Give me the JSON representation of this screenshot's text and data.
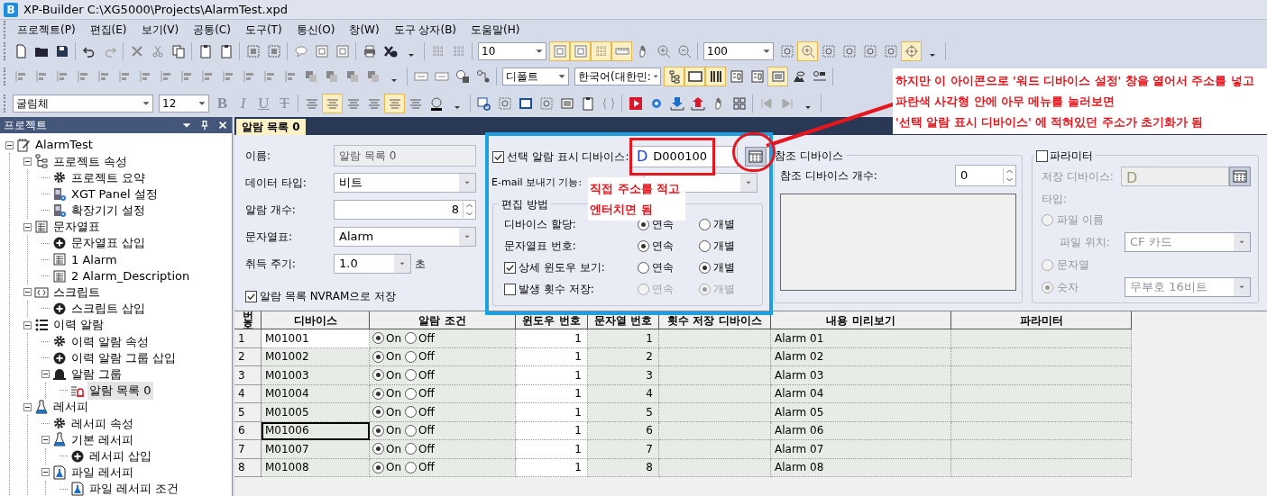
{
  "window": {
    "logo": "B",
    "title": "XP-Builder C:\\XG5000\\Projects\\AlarmTest.xpd"
  },
  "menu": [
    "프로젝트(P)",
    "편집(E)",
    "보기(V)",
    "공통(C)",
    "도구(T)",
    "통신(O)",
    "창(W)",
    "도구 상자(B)",
    "도움말(H)"
  ],
  "toolbar": {
    "rows": [
      [
        {
          "kind": "buttons",
          "buttons": [
            {
              "selected": false
            },
            {
              "selected": false
            },
            {
              "selected": false
            },
            {
              "selected": false
            },
            {
              "selected": false
            },
            {
              "selected": false
            },
            {
              "selected": false
            },
            {
              "selected": false
            },
            {
              "selected": false
            },
            {
              "selected": false
            },
            {
              "selected": false
            },
            {
              "selected": false
            },
            {
              "selected": false
            },
            {
              "selected": false
            },
            {
              "selected": false
            },
            {
              "selected": false
            },
            {
              "selected": false
            },
            {
              "selected": false
            },
            {
              "selected": false
            },
            {
              "selected": false
            }
          ]
        },
        {
          "kind": "field",
          "value": "10"
        },
        {
          "kind": "buttons",
          "buttons": [
            {
              "selected": true
            },
            {
              "selected": true
            },
            {
              "selected": true
            },
            {
              "selected": true
            },
            {
              "selected": false
            },
            {
              "selected": false
            },
            {
              "selected": false
            }
          ]
        },
        {
          "kind": "field",
          "value": "100"
        },
        {
          "kind": "buttons",
          "buttons": [
            {
              "selected": false
            },
            {
              "selected": true
            },
            {
              "selected": false
            },
            {
              "selected": false
            },
            {
              "selected": false
            },
            {
              "selected": false
            },
            {
              "selected": true
            },
            {
              "selected": false
            }
          ]
        }
      ],
      [
        {
          "kind": "buttons",
          "buttons": [
            {
              "selected": false
            },
            {
              "selected": false
            },
            {
              "selected": false
            },
            {
              "selected": false
            },
            {
              "selected": false
            },
            {
              "selected": false
            },
            {
              "selected": false
            },
            {
              "selected": false
            },
            {
              "selected": false
            },
            {
              "selected": false
            },
            {
              "selected": false
            },
            {
              "selected": false
            },
            {
              "selected": false
            },
            {
              "selected": false
            },
            {
              "selected": false
            },
            {
              "selected": false
            },
            {
              "selected": false
            },
            {
              "selected": false
            },
            {
              "selected": false
            },
            {
              "selected": false
            },
            {
              "selected": false
            },
            {
              "selected": false
            },
            {
              "selected": false
            }
          ]
        },
        {
          "kind": "field",
          "value": "디폴트"
        },
        {
          "kind": "field",
          "value": "한국어(대한민:"
        },
        {
          "kind": "buttons",
          "buttons": [
            {
              "selected": true
            },
            {
              "selected": true
            },
            {
              "selected": true
            },
            {
              "selected": false
            },
            {
              "selected": false
            },
            {
              "selected": true
            },
            {
              "selected": false
            },
            {
              "selected": false
            }
          ]
        }
      ],
      [
        {
          "kind": "field",
          "value": "굴림체"
        },
        {
          "kind": "field",
          "value": "12"
        },
        {
          "kind": "format",
          "buttons": [
            {
              "label": "B",
              "kind": "bold"
            },
            {
              "label": "I",
              "kind": "italic"
            },
            {
              "label": "U",
              "kind": "underline"
            },
            {
              "label": "T",
              "kind": "strike"
            }
          ]
        },
        {
          "kind": "buttons",
          "buttons": [
            {
              "selected": false
            },
            {
              "selected": true
            },
            {
              "selected": false
            },
            {
              "selected": false
            },
            {
              "selected": true
            },
            {
              "selected": false
            },
            {
              "selected": false
            },
            {
              "selected": false
            }
          ]
        },
        {
          "kind": "buttons",
          "buttons": [
            {
              "selected": false
            },
            {
              "selected": false
            },
            {
              "selected": false
            },
            {
              "selected": false
            },
            {
              "selected": false
            },
            {
              "selected": false
            },
            {
              "selected": false
            },
            {
              "selected": false
            },
            {
              "selected": false
            },
            {
              "selected": false
            },
            {
              "selected": false
            },
            {
              "selected": false
            },
            {
              "selected": false
            },
            {
              "selected": false
            },
            {
              "selected": false
            },
            {
              "selected": false
            }
          ]
        }
      ]
    ]
  },
  "project_panel": {
    "title": "프로젝트",
    "tree": [
      {
        "label": "AlarmTest",
        "kind": "project",
        "selected": false,
        "expanded": true,
        "children": [
          {
            "label": "프로젝트 속성",
            "kind": "properties",
            "selected": false,
            "expanded": true,
            "children": [
              {
                "label": "프로젝트 요약",
                "kind": "summary",
                "selected": false
              },
              {
                "label": "XGT Panel 설정",
                "kind": "settings",
                "selected": false
              },
              {
                "label": "확장기기 설정",
                "kind": "settings",
                "selected": false
              }
            ]
          },
          {
            "label": "문자열표",
            "kind": "table",
            "selected": false,
            "expanded": true,
            "children": [
              {
                "label": "문자열표 삽입",
                "kind": "insert",
                "selected": false
              },
              {
                "label": "1 Alarm",
                "kind": "table",
                "selected": false
              },
              {
                "label": "2 Alarm_Description",
                "kind": "table",
                "selected": false
              }
            ]
          },
          {
            "label": "스크립트",
            "kind": "script",
            "selected": false,
            "expanded": true,
            "children": [
              {
                "label": "스크립트 삽입",
                "kind": "insert",
                "selected": false
              }
            ]
          },
          {
            "label": "이력 알람",
            "kind": "history",
            "selected": false,
            "expanded": true,
            "children": [
              {
                "label": "이력 알람 속성",
                "kind": "summary",
                "selected": false
              },
              {
                "label": "이력 알람 그룹 삽입",
                "kind": "insert",
                "selected": false
              },
              {
                "label": "알람 그룹",
                "kind": "group",
                "selected": false,
                "expanded": true,
                "children": [
                  {
                    "label": "알람 목록 0",
                    "kind": "list",
                    "selected": true
                  }
                ]
              }
            ]
          },
          {
            "label": "레서피",
            "kind": "recipe",
            "selected": false,
            "expanded": true,
            "children": [
              {
                "label": "레서피 속성",
                "kind": "summary",
                "selected": false
              },
              {
                "label": "기본 레서피",
                "kind": "recipe",
                "selected": false,
                "expanded": true,
                "children": [
                  {
                    "label": "레서피 삽입",
                    "kind": "insert",
                    "selected": false
                  }
                ]
              },
              {
                "label": "파일 레서피",
                "kind": "file",
                "selected": false,
                "expanded": true,
                "children": [
                  {
                    "label": "파일 레서피 조건",
                    "kind": "file",
                    "selected": false
                  }
                ]
              }
            ]
          }
        ]
      }
    ]
  },
  "editor": {
    "tabs": [
      {
        "label": "알람 목록 0",
        "selected": true
      }
    ],
    "general": {
      "name": {
        "label": "이름:",
        "value": "알람 목록 0"
      },
      "data_type": {
        "label": "데이터 타입:",
        "value": "비트"
      },
      "alarm_count": {
        "label": "알람 개수:",
        "value": "8"
      },
      "string_table": {
        "label": "문자열표:",
        "value": "Alarm"
      },
      "interval": {
        "label": "취득 주기:",
        "value": "1.0",
        "unit": "초"
      },
      "nvram": {
        "label": "알람 목록 NVRAM으로 저장",
        "checked": true
      }
    },
    "display_device": {
      "label": "선택 알람 표시 디바이스:",
      "checked": true,
      "prefix": "D",
      "value": "D000100"
    },
    "email": {
      "label": "E-mail 보내기 기능:"
    },
    "edit_method": {
      "title": "편집 방법",
      "rows": [
        {
          "label": "디바이스 할당:",
          "kind": "plain",
          "disabled": false,
          "options": [
            {
              "label": "연속",
              "selected": true
            },
            {
              "label": "개별",
              "selected": false
            }
          ]
        },
        {
          "label": "문자열표 번호:",
          "kind": "plain",
          "disabled": false,
          "options": [
            {
              "label": "연속",
              "selected": true
            },
            {
              "label": "개별",
              "selected": false
            }
          ]
        },
        {
          "label": "상세 윈도우 보기:",
          "kind": "check",
          "checked": true,
          "disabled": false,
          "options": [
            {
              "label": "연속",
              "selected": false
            },
            {
              "label": "개별",
              "selected": true
            }
          ]
        },
        {
          "label": "발생 횟수 저장:",
          "kind": "check",
          "checked": false,
          "disabled": true,
          "options": [
            {
              "label": "연속",
              "selected": false
            },
            {
              "label": "개별",
              "selected": true
            }
          ]
        }
      ]
    },
    "reference": {
      "title": "참조 디바이스",
      "count": {
        "label": "참조 디바이스 개수:",
        "value": "0"
      }
    },
    "parameter": {
      "title": "파라미터",
      "checked": false,
      "disabled": true,
      "device": {
        "label": "저장 디바이스:",
        "prefix": "D"
      },
      "type_label": "타입:",
      "file_name": {
        "label": "파일 이름",
        "selected": false
      },
      "file_location": {
        "label": "파일 위치:",
        "value": "CF 카드"
      },
      "string": {
        "label": "문자열",
        "selected": false
      },
      "number": {
        "label": "숫자",
        "selected": true,
        "value": "무부호 16비트"
      }
    }
  },
  "table": {
    "columns": [
      "번호",
      "디바이스",
      "알람 조건",
      "윈도우 번호",
      "문자열 번호",
      "횟수 저장 디바이스",
      "내용 미리보기",
      "파라미터"
    ],
    "rows": [
      {
        "number": "1",
        "device": "M01001",
        "selected": false,
        "condition": [
          {
            "label": "On",
            "selected": true
          },
          {
            "label": "Off",
            "selected": false
          }
        ],
        "window": "1",
        "string": "1",
        "preview": "Alarm 01"
      },
      {
        "number": "2",
        "device": "M01002",
        "selected": false,
        "condition": [
          {
            "label": "On",
            "selected": true
          },
          {
            "label": "Off",
            "selected": false
          }
        ],
        "window": "1",
        "string": "2",
        "preview": "Alarm 02"
      },
      {
        "number": "3",
        "device": "M01003",
        "selected": false,
        "condition": [
          {
            "label": "On",
            "selected": true
          },
          {
            "label": "Off",
            "selected": false
          }
        ],
        "window": "1",
        "string": "3",
        "preview": "Alarm 03"
      },
      {
        "number": "4",
        "device": "M01004",
        "selected": false,
        "condition": [
          {
            "label": "On",
            "selected": true
          },
          {
            "label": "Off",
            "selected": false
          }
        ],
        "window": "1",
        "string": "4",
        "preview": "Alarm 04"
      },
      {
        "number": "5",
        "device": "M01005",
        "selected": false,
        "condition": [
          {
            "label": "On",
            "selected": true
          },
          {
            "label": "Off",
            "selected": false
          }
        ],
        "window": "1",
        "string": "5",
        "preview": "Alarm 05"
      },
      {
        "number": "6",
        "device": "M01006",
        "selected": true,
        "condition": [
          {
            "label": "On",
            "selected": true
          },
          {
            "label": "Off",
            "selected": false
          }
        ],
        "window": "1",
        "string": "6",
        "preview": "Alarm 06"
      },
      {
        "number": "7",
        "device": "M01007",
        "selected": false,
        "condition": [
          {
            "label": "On",
            "selected": true
          },
          {
            "label": "Off",
            "selected": false
          }
        ],
        "window": "1",
        "string": "7",
        "preview": "Alarm 07"
      },
      {
        "number": "8",
        "device": "M01008",
        "selected": false,
        "condition": [
          {
            "label": "On",
            "selected": true
          },
          {
            "label": "Off",
            "selected": false
          }
        ],
        "window": "1",
        "string": "8",
        "preview": "Alarm 08"
      }
    ]
  },
  "notes": [
    {
      "lines": [
        "하지만 이 아이콘으로 '워드 디바이스 설정' 창을 열어서 주소를 넣고",
        "파란색 사각형 안에 아무 메뉴를 눌러보면",
        "'선택 알람 표시 디바이스' 에 적혀있던 주소가 초기화가 됨"
      ]
    },
    {
      "lines": [
        "직접 주소를 적고",
        "엔터치면 됨"
      ]
    }
  ]
}
